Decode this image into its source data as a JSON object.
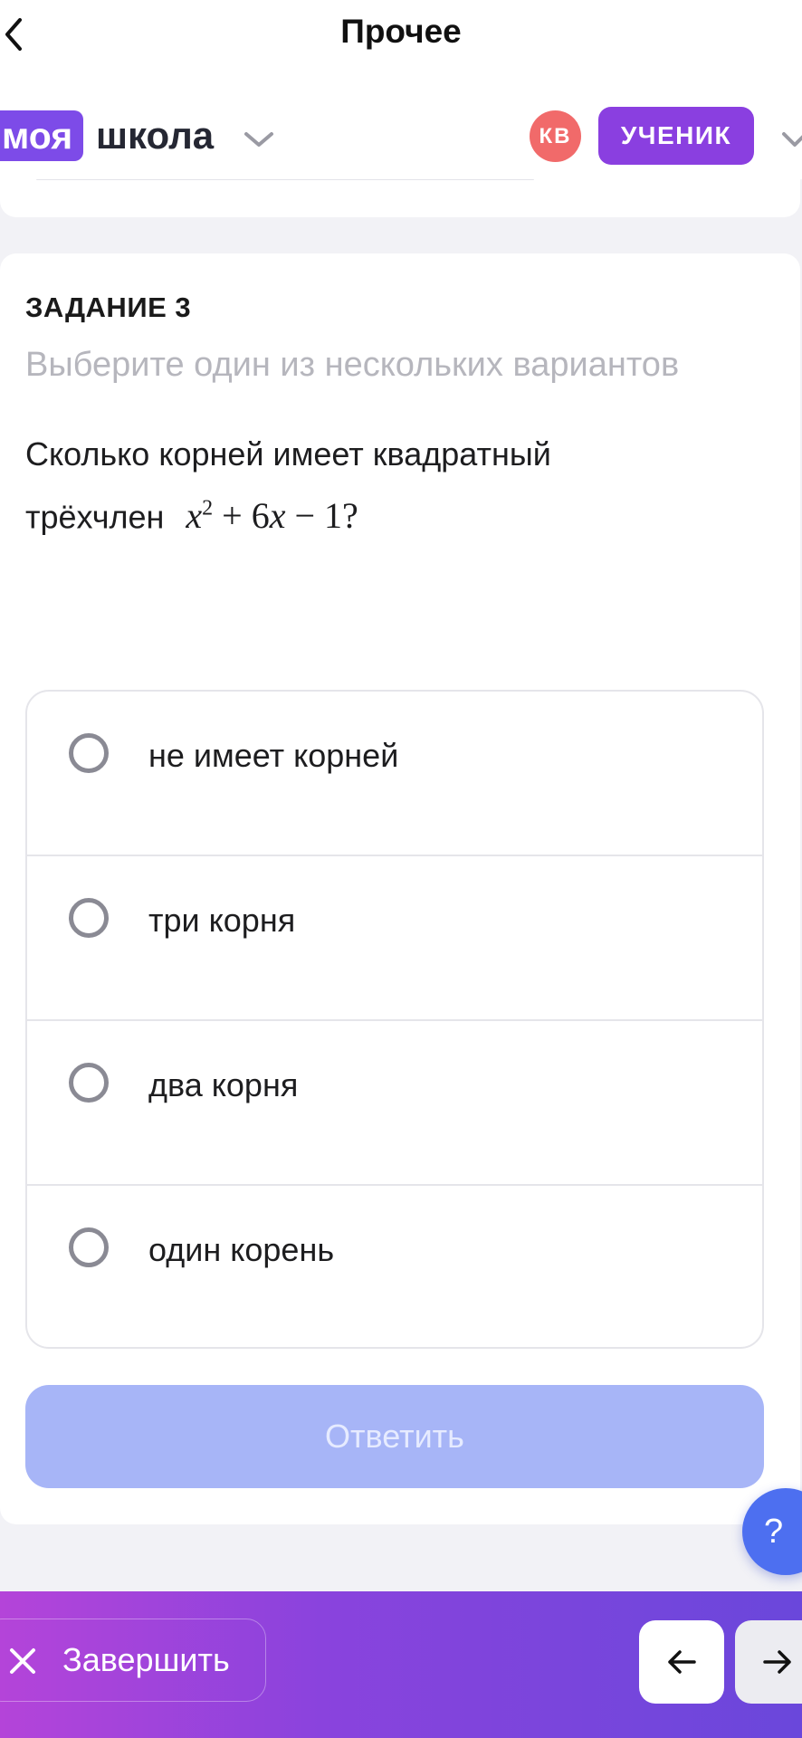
{
  "topbar": {
    "title": "Прочее"
  },
  "header": {
    "logo_part1": "моя",
    "logo_part2": "школа",
    "avatar_initials": "КВ",
    "role_label": "УЧЕНИК"
  },
  "task": {
    "number_label": "ЗАДАНИЕ 3",
    "instruction": "Выберите один из нескольких вариантов",
    "question_line1": "Сколько корней имеет квадратный",
    "question_line2": "трёхчлен",
    "formula": "x² + 6x − 1?"
  },
  "options": [
    {
      "label": "не имеет корней",
      "selected": false
    },
    {
      "label": "три корня",
      "selected": false
    },
    {
      "label": "два корня",
      "selected": false
    },
    {
      "label": "один корень",
      "selected": false
    }
  ],
  "answer_button": {
    "label": "Ответить",
    "enabled": false
  },
  "help": {
    "label": "?"
  },
  "footer": {
    "finish_label": "Завершить"
  },
  "icons": {
    "back": "chevron-left-icon",
    "dropdown": "chevron-down-icon",
    "finish": "close-icon",
    "prev": "arrow-left-icon",
    "next": "arrow-right-icon"
  },
  "colors": {
    "brand_purple": "#8a3fe0",
    "avatar_red": "#f16a6a",
    "answer_disabled": "#a7b5f7",
    "help_blue": "#4d6ff0"
  }
}
